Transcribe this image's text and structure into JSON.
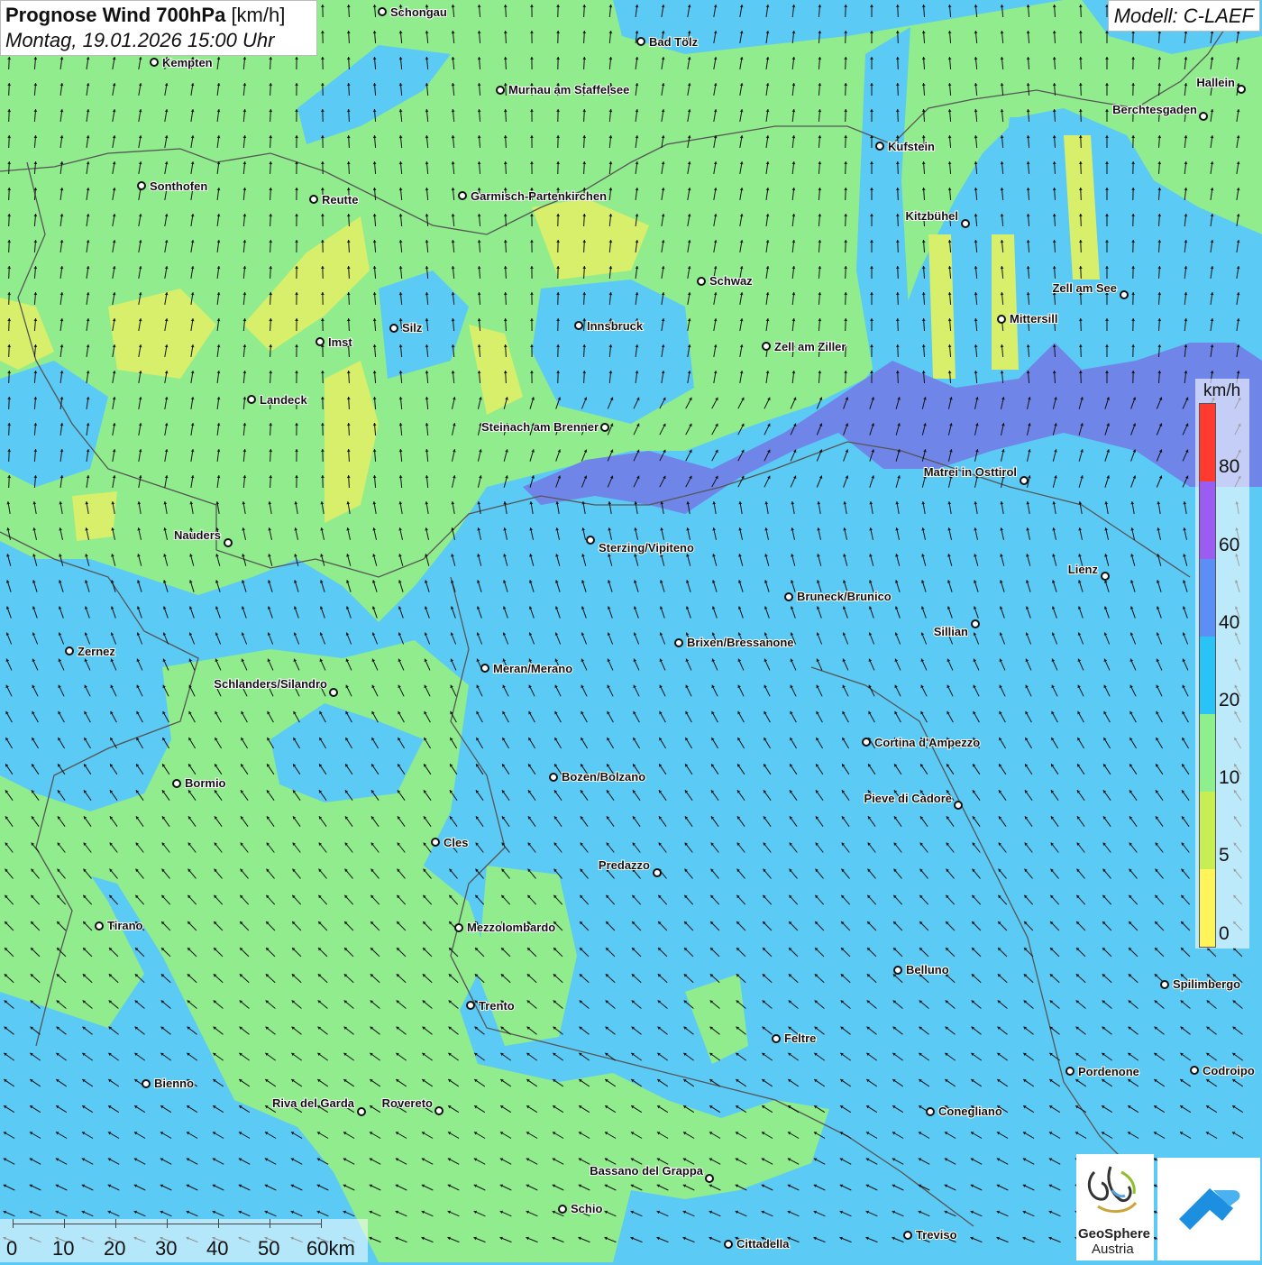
{
  "title": {
    "main": "Prognose Wind 700hPa",
    "unit": "[km/h]",
    "datetime": "Montag, 19.01.2026 15:00 Uhr"
  },
  "model": "Modell: C-LAEF",
  "legend": {
    "unit": "km/h",
    "ticks": [
      "80",
      "60",
      "40",
      "20",
      "10",
      "5",
      "0"
    ],
    "colors": [
      "#ff3b30",
      "#9b5cf2",
      "#5b8ff5",
      "#29c3f5",
      "#8ef08c",
      "#c7ef53",
      "#fff45a"
    ]
  },
  "scale": {
    "labels": [
      "0",
      "10",
      "20",
      "30",
      "40",
      "50",
      "60km"
    ]
  },
  "logos": {
    "geosphere_line1": "GeoSphere",
    "geosphere_line2": "Austria",
    "geosphere_icon": "geosphere-swirl-icon",
    "cloud_icon": "cloud-arrow-icon"
  },
  "colors": {
    "speed_0_5": "#f5f075",
    "speed_5_10": "#d7ef6a",
    "speed_10_20": "#90ec8c",
    "speed_20_40": "#5bcaf5",
    "speed_40_60": "#6f86e8",
    "border": "#555555"
  },
  "cities": [
    {
      "name": "Schongau"
    },
    {
      "name": "Bad Tölz"
    },
    {
      "name": "Kempten"
    },
    {
      "name": "Murnau am Staffelsee"
    },
    {
      "name": "Hallein"
    },
    {
      "name": "Berchtesgaden"
    },
    {
      "name": "Kufstein"
    },
    {
      "name": "Sonthofen"
    },
    {
      "name": "Reutte"
    },
    {
      "name": "Garmisch-Partenkirchen"
    },
    {
      "name": "Kitzbühel"
    },
    {
      "name": "Schwaz"
    },
    {
      "name": "Zell am See"
    },
    {
      "name": "Silz"
    },
    {
      "name": "Innsbruck"
    },
    {
      "name": "Mittersill"
    },
    {
      "name": "Imst"
    },
    {
      "name": "Zell am Ziller"
    },
    {
      "name": "Landeck"
    },
    {
      "name": "Steinach am Brenner"
    },
    {
      "name": "Matrei in Osttirol"
    },
    {
      "name": "Nauders"
    },
    {
      "name": "Sterzing/Vipiteno"
    },
    {
      "name": "Lienz"
    },
    {
      "name": "Bruneck/Brunico"
    },
    {
      "name": "Sillian"
    },
    {
      "name": "Brixen/Bressanone"
    },
    {
      "name": "Zernez"
    },
    {
      "name": "Meran/Merano"
    },
    {
      "name": "Schlanders/Silandro"
    },
    {
      "name": "Cortina d'Ampezzo"
    },
    {
      "name": "Bormio"
    },
    {
      "name": "Bozen/Bolzano"
    },
    {
      "name": "Pieve di Cadore"
    },
    {
      "name": "Cles"
    },
    {
      "name": "Predazzo"
    },
    {
      "name": "Tirano"
    },
    {
      "name": "Mezzolombardo"
    },
    {
      "name": "Belluno"
    },
    {
      "name": "Spilimbergo"
    },
    {
      "name": "Trento"
    },
    {
      "name": "Feltre"
    },
    {
      "name": "Bienno"
    },
    {
      "name": "Pordenone"
    },
    {
      "name": "Codroipo"
    },
    {
      "name": "Riva del Garda"
    },
    {
      "name": "Rovereto"
    },
    {
      "name": "Conegliano"
    },
    {
      "name": "Bassano del Grappa"
    },
    {
      "name": "Schio"
    },
    {
      "name": "Treviso"
    },
    {
      "name": "Cittadella"
    }
  ]
}
